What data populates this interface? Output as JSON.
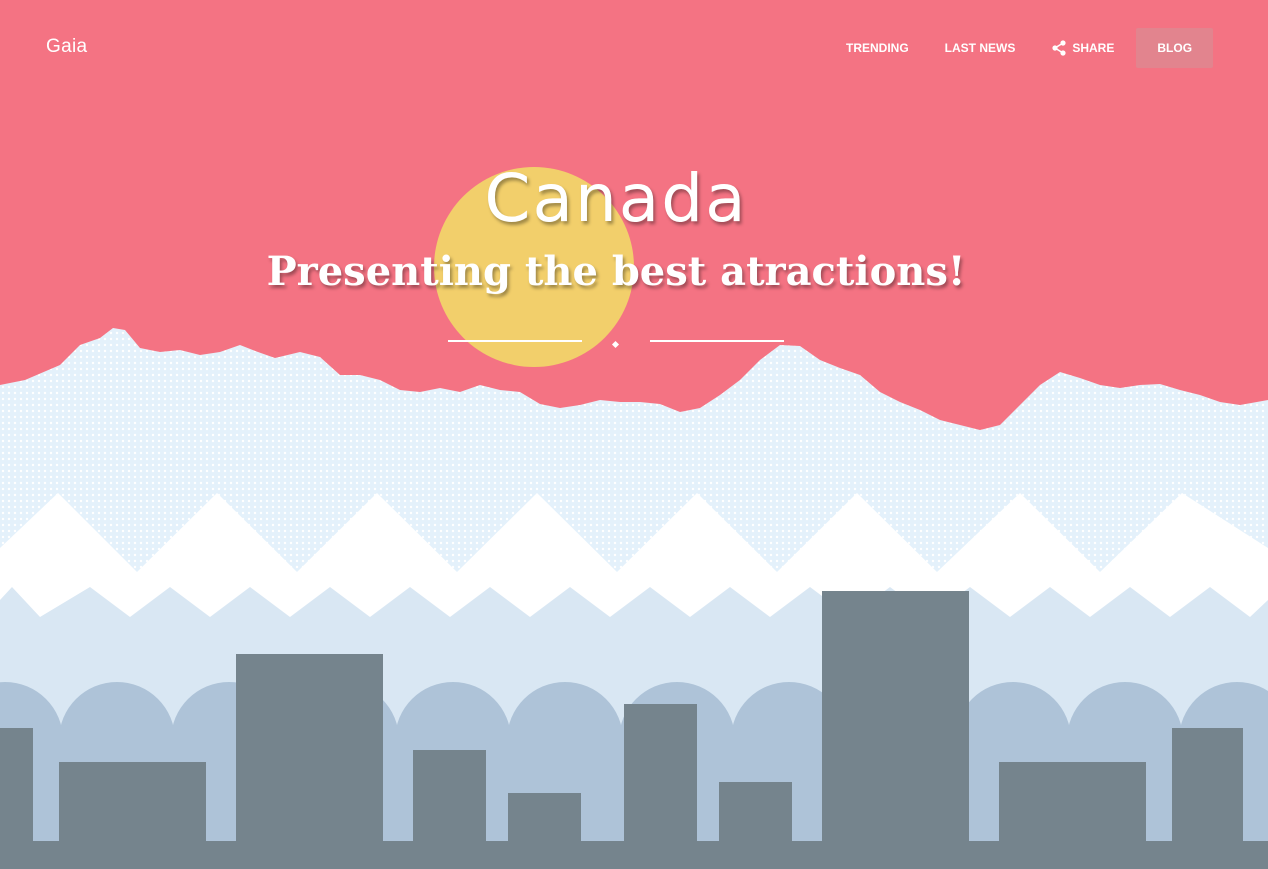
{
  "nav": {
    "brand": "Gaia",
    "trending": "TRENDING",
    "last_news": "LAST NEWS",
    "share": "SHARE",
    "blog": "BLOG"
  },
  "hero": {
    "title": "Canada",
    "subtitle": "Presenting the best atractions!"
  },
  "colors": {
    "sky": "#f47383",
    "sun": "#f2cf6b",
    "mountain_snow": "#e4f1fb",
    "zigzag": "#ffffff",
    "far_city": "#d9e7f3",
    "trees": "#aec3d8",
    "buildings": "#75848d",
    "blog_button": "#e0858e"
  },
  "icons": {
    "share": "share-icon"
  }
}
